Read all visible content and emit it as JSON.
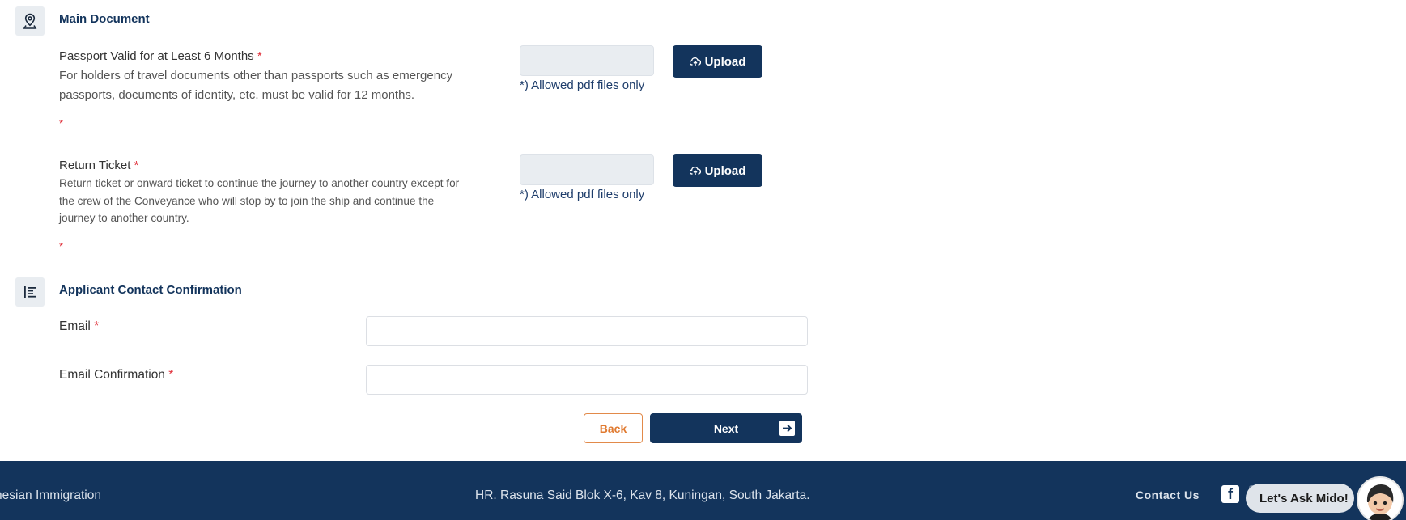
{
  "main_document": {
    "title": "Main Document",
    "icon": "map-pin-icon",
    "documents": [
      {
        "label": "Passport Valid for at Least 6 Months",
        "required_mark": "*",
        "description_line1": "For holders of travel documents other than passports such as emergency",
        "description_line2": "passports, documents of identity, etc. must be valid for 12 months.",
        "error_mark": "*",
        "allowed_note": "*) Allowed pdf files only",
        "upload_label": "Upload"
      },
      {
        "label": "Return Ticket",
        "required_mark": "*",
        "description_line1": "Return ticket or onward ticket to continue the journey to another country except for",
        "description_line2": "the crew of the Conveyance who will stop by to join the ship and continue the",
        "description_line3": "journey to another country.",
        "error_mark": "*",
        "allowed_note": "*) Allowed pdf files only",
        "upload_label": "Upload"
      }
    ]
  },
  "contact": {
    "title": "Applicant Contact Confirmation",
    "icon": "list-icon",
    "email_label": "Email",
    "email_value": "",
    "email_confirm_label": "Email Confirmation",
    "email_confirm_value": "",
    "required_mark": "*"
  },
  "actions": {
    "back_label": "Back",
    "next_label": "Next",
    "next_icon": "arrow-right-icon"
  },
  "footer": {
    "left_text": "nesian Immigration",
    "address": "HR. Rasuna Said Blok X-6, Kav 8, Kuningan, South Jakarta.",
    "contact_label": "Contact Us",
    "social_icons": [
      "facebook-icon",
      "instagram-icon",
      "twitter-icon",
      "youtube-icon"
    ]
  },
  "chat": {
    "label": "Let's Ask Mido!",
    "icon": "mido-avatar"
  },
  "colors": {
    "primary": "#13345c",
    "accent_orange": "#e07a30",
    "required_red": "#e0303a",
    "muted_box": "#e9edf1"
  }
}
